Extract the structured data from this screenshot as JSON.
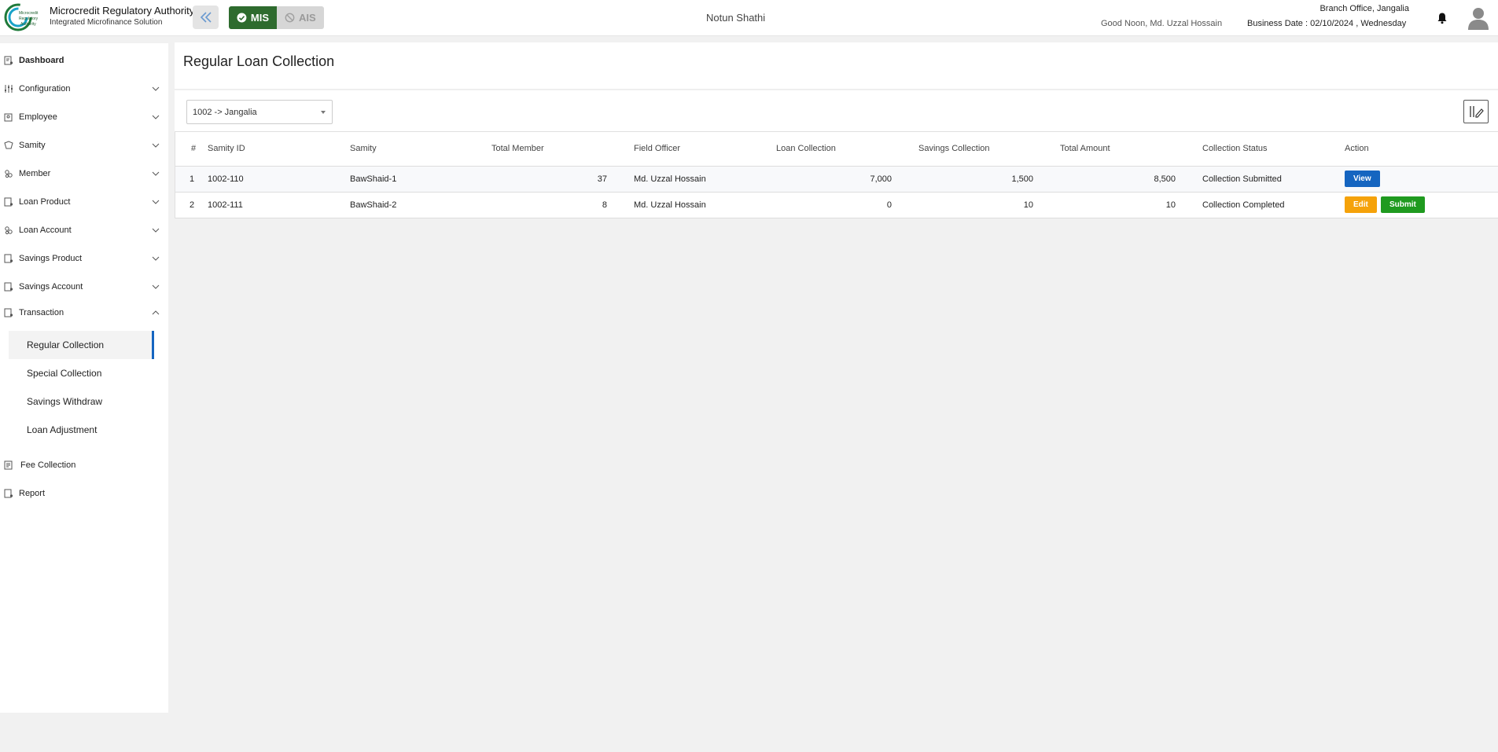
{
  "header": {
    "brand_title": "Microcredit Regulatory Authority",
    "brand_subtitle": "Integrated Microfinance Solution",
    "logo_text_line1": "Microcredit",
    "logo_text_line2": "Regulatory",
    "logo_text_line3": "Authority",
    "mode_mis": "MIS",
    "mode_ais": "AIS",
    "org_name": "Notun Shathi",
    "greeting": "Good Noon, Md. Uzzal Hossain",
    "branch": "Branch Office, Jangalia",
    "business_date": "Business Date : 02/10/2024 , Wednesday",
    "colors": {
      "mis": "#2e6b2e",
      "accent": "#1565c0"
    }
  },
  "sidebar": {
    "items": [
      {
        "label": "Dashboard",
        "icon": "dashboard-icon"
      },
      {
        "label": "Configuration",
        "icon": "sliders-icon"
      },
      {
        "label": "Employee",
        "icon": "employee-icon"
      },
      {
        "label": "Samity",
        "icon": "samity-icon"
      },
      {
        "label": "Member",
        "icon": "member-icon"
      },
      {
        "label": "Loan Product",
        "icon": "loan-product-icon"
      },
      {
        "label": "Loan Account",
        "icon": "loan-account-icon"
      },
      {
        "label": "Savings Product",
        "icon": "savings-product-icon"
      },
      {
        "label": "Savings Account",
        "icon": "savings-account-icon"
      },
      {
        "label": "Transaction",
        "icon": "transaction-icon"
      },
      {
        "label": "Fee Collection",
        "icon": "fee-collection-icon"
      },
      {
        "label": "Report",
        "icon": "report-icon"
      }
    ],
    "transaction_sub": [
      {
        "label": "Regular Collection",
        "active": true
      },
      {
        "label": "Special Collection"
      },
      {
        "label": "Savings Withdraw"
      },
      {
        "label": "Loan Adjustment"
      }
    ]
  },
  "main": {
    "page_title": "Regular Loan Collection",
    "branch_select": "1002 -> Jangalia",
    "table": {
      "columns": [
        "#",
        "Samity ID",
        "Samity",
        "Total Member",
        "Field Officer",
        "Loan Collection",
        "Savings Collection",
        "Total Amount",
        "Collection Status",
        "Action"
      ],
      "rows": [
        {
          "num": "1",
          "samity_id": "1002-110",
          "samity": "BawShaid-1",
          "total_member": "37",
          "field_officer": "Md. Uzzal Hossain",
          "loan_collection": "7,000",
          "savings_collection": "1,500",
          "total_amount": "8,500",
          "status": "Collection Submitted",
          "actions": [
            "View"
          ]
        },
        {
          "num": "2",
          "samity_id": "1002-111",
          "samity": "BawShaid-2",
          "total_member": "8",
          "field_officer": "Md. Uzzal Hossain",
          "loan_collection": "0",
          "savings_collection": "10",
          "total_amount": "10",
          "status": "Collection Completed",
          "actions": [
            "Edit",
            "Submit"
          ]
        }
      ]
    }
  }
}
